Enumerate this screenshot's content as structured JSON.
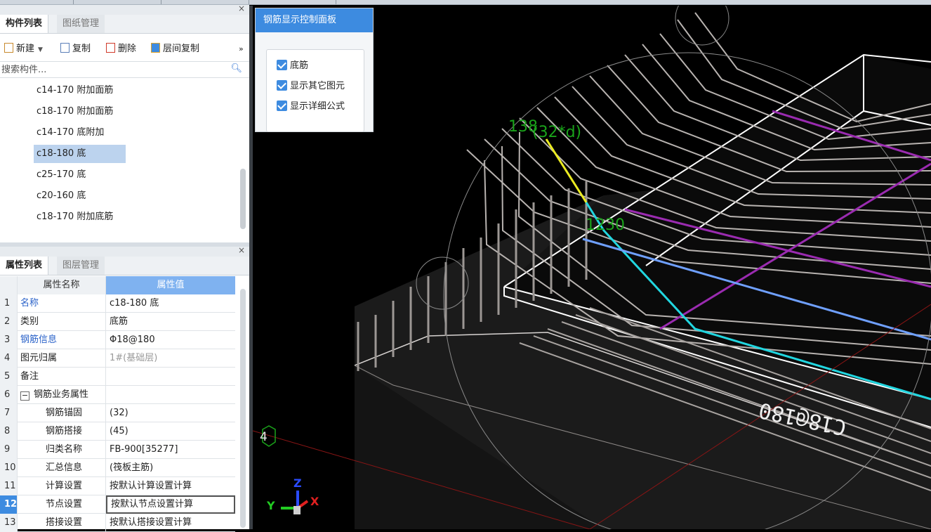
{
  "components_panel": {
    "tab_active": "构件列表",
    "tab_inactive": "图纸管理",
    "toolbar": {
      "new": "新建",
      "copy": "复制",
      "delete": "删除",
      "floor_copy": "层间复制",
      "more": "»"
    },
    "search_placeholder": "搜索构件...",
    "items": [
      "c14-170 附加面筋",
      "c18-170 附加面筋",
      "c14-170 底附加",
      "c18-180 底",
      "c25-170 底",
      "c20-160 底",
      "c18-170 附加底筋"
    ],
    "selected_index": 3
  },
  "properties_panel": {
    "tab_active": "属性列表",
    "tab_inactive": "图层管理",
    "col_name": "属性名称",
    "col_value": "属性值",
    "rows": [
      {
        "idx": "1",
        "name": "名称",
        "value": "c18-180 底"
      },
      {
        "idx": "2",
        "name": "类别",
        "value": "底筋"
      },
      {
        "idx": "3",
        "name": "钢筋信息",
        "value": "Φ18@180"
      },
      {
        "idx": "4",
        "name": "图元归属",
        "value": "1#(基础层)"
      },
      {
        "idx": "5",
        "name": "备注",
        "value": ""
      },
      {
        "idx": "6",
        "name": "钢筋业务属性",
        "value": "",
        "toggle": "−"
      },
      {
        "idx": "7",
        "name": "钢筋锚固",
        "value": "(32)"
      },
      {
        "idx": "8",
        "name": "钢筋搭接",
        "value": "(45)"
      },
      {
        "idx": "9",
        "name": "归类名称",
        "value": "FB-900[35277]"
      },
      {
        "idx": "10",
        "name": "汇总信息",
        "value": "(筏板主筋)"
      },
      {
        "idx": "11",
        "name": "计算设置",
        "value": "按默认计算设置计算"
      },
      {
        "idx": "12",
        "name": "节点设置",
        "value": "按默认节点设置计算"
      },
      {
        "idx": "13",
        "name": "搭接设置",
        "value": "按默认搭接设置计算"
      }
    ]
  },
  "control_panel": {
    "title": "钢筋显示控制面板",
    "options": [
      "底筋",
      "显示其它图元",
      "显示详细公式"
    ]
  },
  "viewport": {
    "dim_label_top": "138",
    "dim_formula": "(32*d)",
    "dim_label_mid": "1230",
    "grid_axis_label": "4",
    "rebar_text": "C18@180",
    "axis_labels": {
      "x": "X",
      "y": "Y",
      "z": "Z"
    }
  },
  "colors": {
    "accent": "#3d8be0",
    "dim_green": "#1aa31a",
    "rebar_white": "#e8e4e2",
    "magenta": "#9a2bb0",
    "cyan": "#21d6e0",
    "yellow": "#ecec22",
    "lightblue": "#6fa0ff"
  }
}
